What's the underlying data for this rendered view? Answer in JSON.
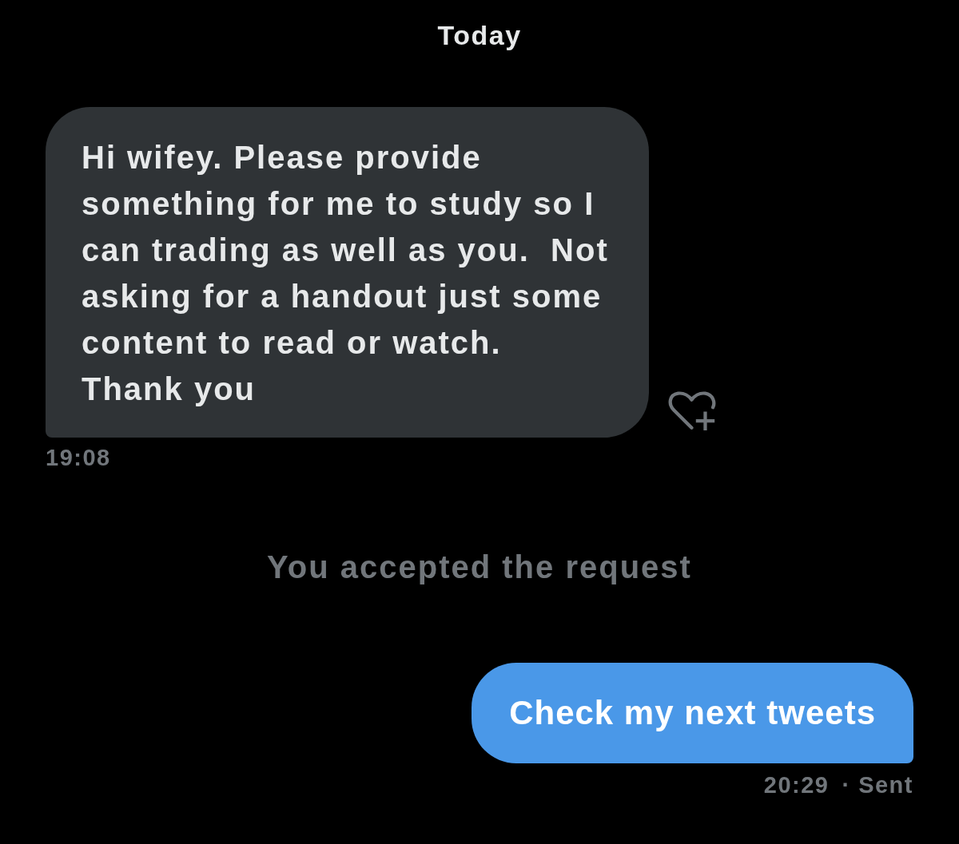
{
  "conversation": [
    {
      "kind": "date",
      "text": "Today"
    },
    {
      "kind": "received",
      "text": "Hi wifey. Please provide something for me to study so I can trading as well as you.  Not asking for a handout just some content to read or watch.\nThank you",
      "time": "19:08"
    },
    {
      "kind": "notice",
      "text": "You accepted the request"
    },
    {
      "kind": "sent",
      "text": "Check my next tweets",
      "time": "20:29",
      "status": "· Sent"
    }
  ]
}
